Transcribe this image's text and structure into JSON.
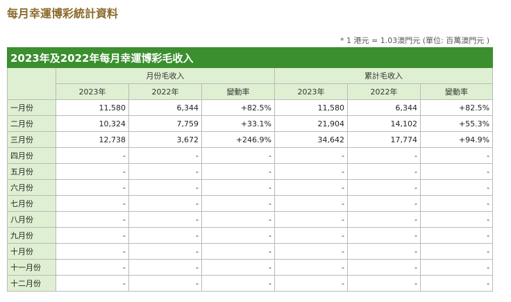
{
  "page": {
    "title": "每月幸運博彩統計資料",
    "note": "* 1 港元 = 1.03澳門元 (單位: 百萬澳門元 )"
  },
  "table": {
    "caption": "2023年及2022年每月幸運博彩毛收入",
    "group_headers": [
      "月份毛收入",
      "累計毛收入"
    ],
    "sub_headers": [
      "2023年",
      "2022年",
      "變動率",
      "2023年",
      "2022年",
      "變動率"
    ],
    "rows": [
      {
        "month": "一月份",
        "cells": [
          "11,580",
          "6,344",
          "+82.5%",
          "11,580",
          "6,344",
          "+82.5%"
        ]
      },
      {
        "month": "二月份",
        "cells": [
          "10,324",
          "7,759",
          "+33.1%",
          "21,904",
          "14,102",
          "+55.3%"
        ]
      },
      {
        "month": "三月份",
        "cells": [
          "12,738",
          "3,672",
          "+246.9%",
          "34,642",
          "17,774",
          "+94.9%"
        ]
      },
      {
        "month": "四月份",
        "cells": [
          "-",
          "-",
          "-",
          "-",
          "-",
          "-"
        ]
      },
      {
        "month": "五月份",
        "cells": [
          "-",
          "-",
          "-",
          "-",
          "-",
          "-"
        ]
      },
      {
        "month": "六月份",
        "cells": [
          "-",
          "-",
          "-",
          "-",
          "-",
          "-"
        ]
      },
      {
        "month": "七月份",
        "cells": [
          "-",
          "-",
          "-",
          "-",
          "-",
          "-"
        ]
      },
      {
        "month": "八月份",
        "cells": [
          "-",
          "-",
          "-",
          "-",
          "-",
          "-"
        ]
      },
      {
        "month": "九月份",
        "cells": [
          "-",
          "-",
          "-",
          "-",
          "-",
          "-"
        ]
      },
      {
        "month": "十月份",
        "cells": [
          "-",
          "-",
          "-",
          "-",
          "-",
          "-"
        ]
      },
      {
        "month": "十一月份",
        "cells": [
          "-",
          "-",
          "-",
          "-",
          "-",
          "-"
        ]
      },
      {
        "month": "十二月份",
        "cells": [
          "-",
          "-",
          "-",
          "-",
          "-",
          "-"
        ]
      }
    ]
  },
  "colors": {
    "title": "#8a6a2a",
    "caption_bg": "#3b8f2f",
    "header_bg": "#dff0d2",
    "border": "#b9b9b9"
  }
}
